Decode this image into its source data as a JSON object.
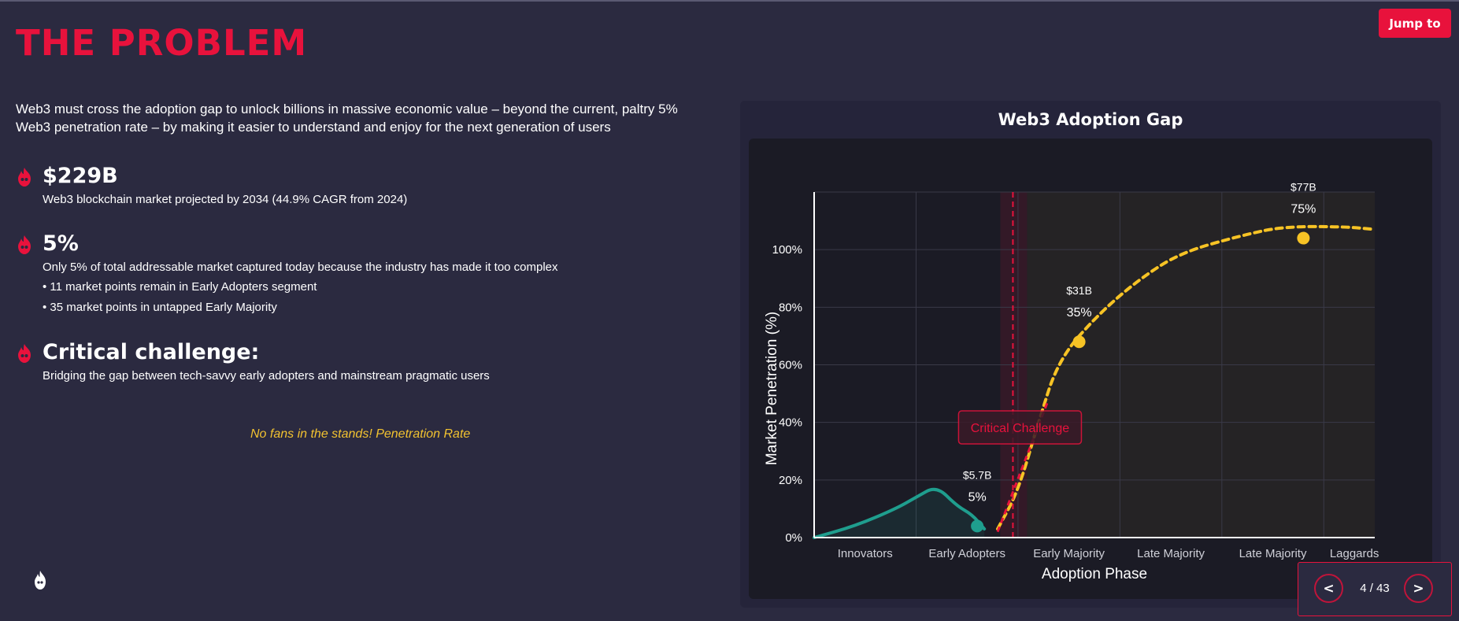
{
  "header": {
    "title": "THE PROBLEM",
    "jump_label": "Jump to"
  },
  "intro": "Web3 must cross the adoption gap to unlock billions in massive economic value – beyond the current, paltry 5% Web3 penetration rate – by making it easier to understand and enjoy for the next generation of users",
  "stats": [
    {
      "icon": "fire-icon",
      "headline": "$229B",
      "lines": [
        "Web3 blockchain market projected by 2034 (44.9% CAGR from 2024)"
      ]
    },
    {
      "icon": "fire-icon",
      "headline": "5%",
      "lines": [
        "Only 5% of total addressable market captured today because the industry has made it too complex",
        "• 11 market points remain in Early Adopters segment",
        "• 35 market points in untapped Early Majority"
      ]
    },
    {
      "icon": "fire-icon",
      "headline": "Critical challenge:",
      "lines": [
        "Bridging the gap between tech-savvy early adopters and mainstream pragmatic users"
      ]
    }
  ],
  "tagline": "No fans in the stands! Penetration Rate",
  "navigation": {
    "prev_label": "<",
    "next_label": ">",
    "page_indicator": "4 / 43"
  },
  "colors": {
    "accent": "#e8123c",
    "background": "#2b2a40",
    "teal": "#1f9e8e",
    "yellow": "#f7c325"
  },
  "chart_data": {
    "type": "line",
    "title": "Web3 Adoption Gap",
    "xlabel": "Adoption Phase",
    "ylabel": "Market Penetration (%)",
    "categories": [
      "Innovators",
      "Early Adopters",
      "Early Majority",
      "Late Majority",
      "Late Majority",
      "Laggards"
    ],
    "yticks": [
      "0%",
      "20%",
      "40%",
      "60%",
      "80%",
      "100%"
    ],
    "ylim": [
      0,
      120
    ],
    "grid": true,
    "annotation": "Critical Challenge",
    "series": [
      {
        "color": "#1f9e8e",
        "style": "solid",
        "x": [
          0,
          0.4,
          0.8,
          1.0,
          1.2,
          1.4,
          1.55,
          1.67
        ],
        "y": [
          0,
          4,
          10,
          14,
          18,
          11,
          8,
          3
        ]
      },
      {
        "color": "#f7c325",
        "style": "dashed",
        "x": [
          1.8,
          2.0,
          2.2,
          2.4,
          2.8,
          3.2,
          3.6,
          4.2,
          4.6,
          5.2,
          5.5
        ],
        "y": [
          3,
          16,
          40,
          62,
          78,
          90,
          99,
          105,
          108,
          108,
          107
        ]
      }
    ],
    "points": [
      {
        "x": 1.6,
        "y": 4,
        "value": "$5.7B",
        "pct": "5%",
        "color": "#1f9e8e"
      },
      {
        "x": 2.6,
        "y": 68,
        "value": "$31B",
        "pct": "35%",
        "color": "#f7c325"
      },
      {
        "x": 4.8,
        "y": 104,
        "value": "$77B",
        "pct": "75%",
        "color": "#f7c325"
      }
    ],
    "critical_x": 1.95
  }
}
